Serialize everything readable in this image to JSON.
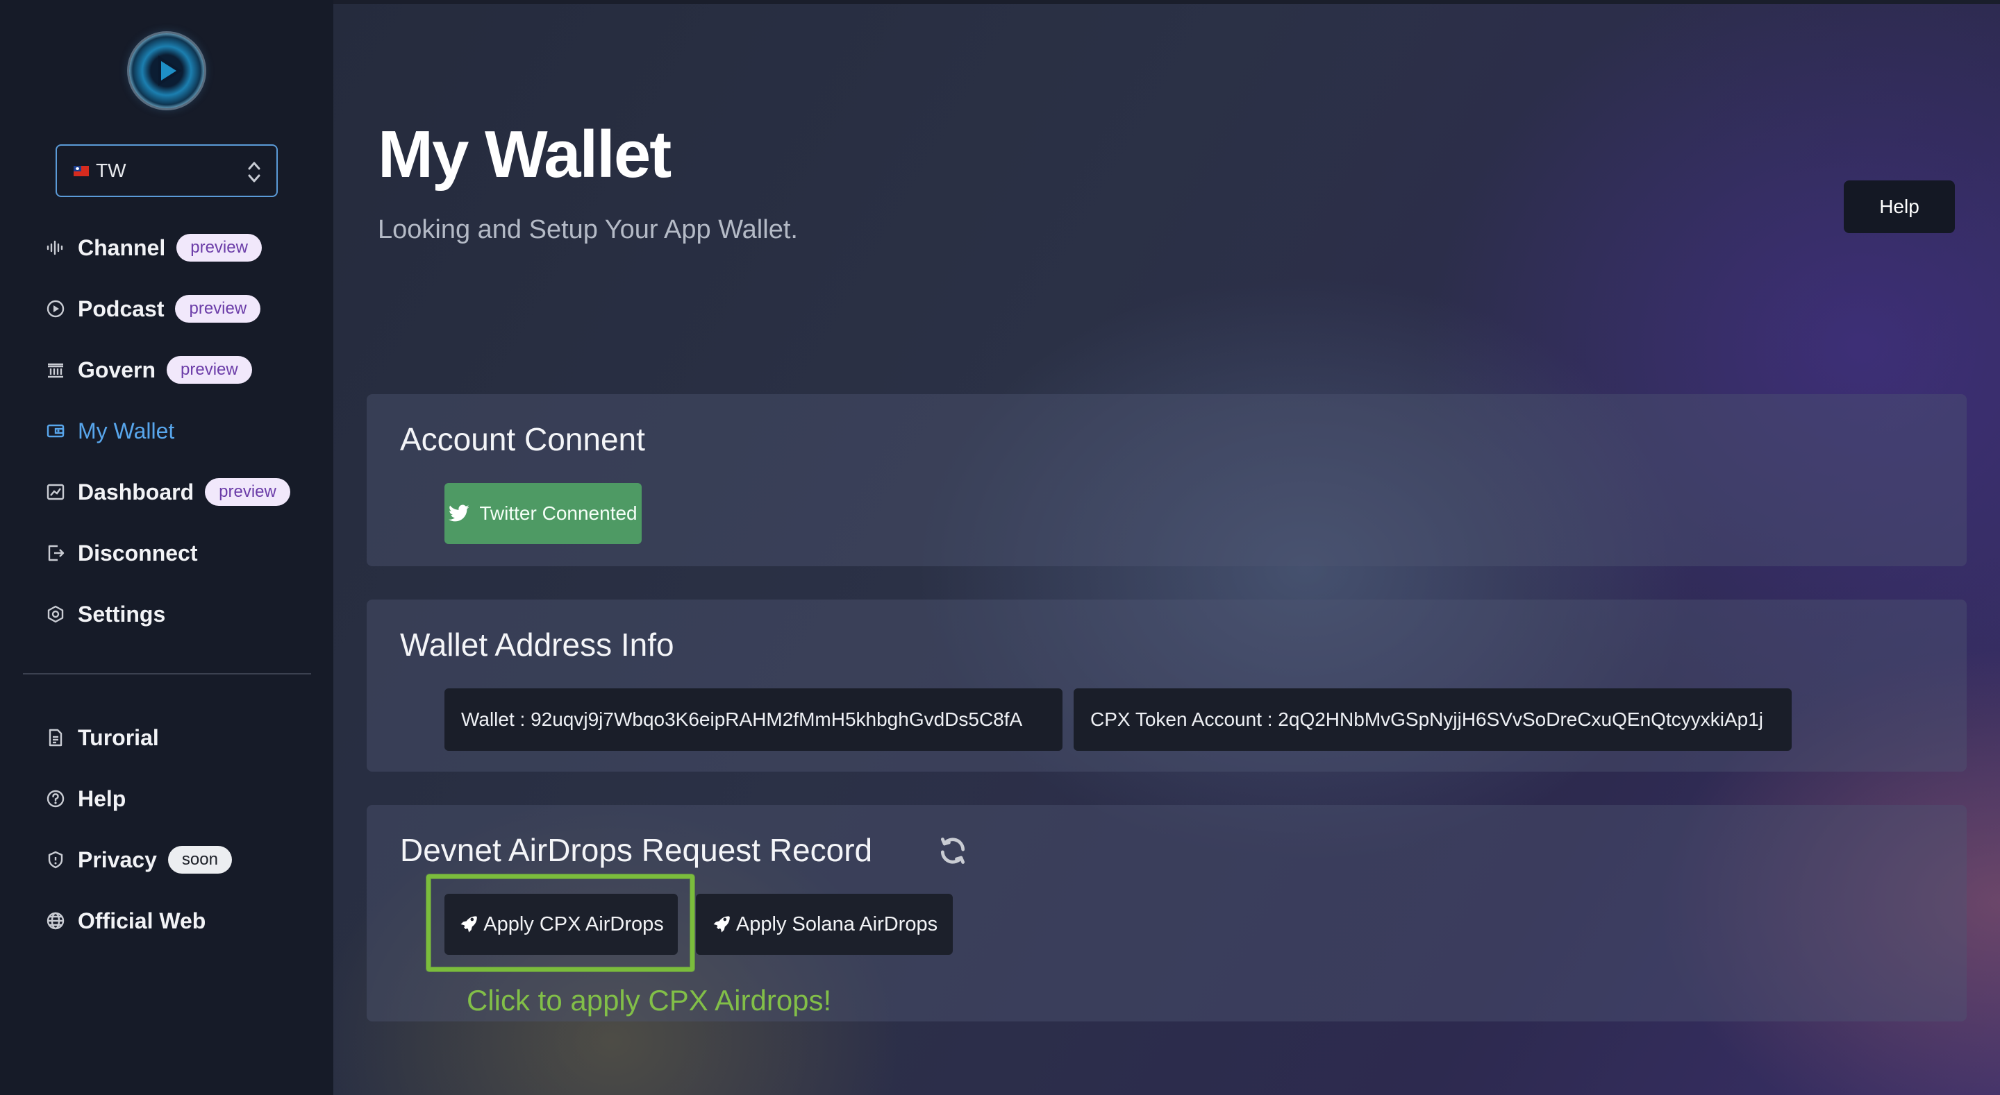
{
  "sidebar": {
    "language": "TW",
    "nav": [
      {
        "label": "Channel",
        "badge": "preview",
        "icon": "audio-wave-icon"
      },
      {
        "label": "Podcast",
        "badge": "preview",
        "icon": "play-circle-icon"
      },
      {
        "label": "Govern",
        "badge": "preview",
        "icon": "bank-icon"
      },
      {
        "label": "My Wallet",
        "badge": "",
        "icon": "wallet-icon",
        "active": true
      },
      {
        "label": "Dashboard",
        "badge": "preview",
        "icon": "chart-icon"
      },
      {
        "label": "Disconnect",
        "badge": "",
        "icon": "logout-icon"
      },
      {
        "label": "Settings",
        "badge": "",
        "icon": "hexagon-gear-icon"
      }
    ],
    "secondary": [
      {
        "label": "Turorial",
        "badge": "",
        "icon": "document-icon"
      },
      {
        "label": "Help",
        "badge": "",
        "icon": "question-circle-icon"
      },
      {
        "label": "Privacy",
        "badge": "soon",
        "icon": "shield-icon"
      },
      {
        "label": "Official Web",
        "badge": "",
        "icon": "globe-icon"
      }
    ]
  },
  "header": {
    "title": "My Wallet",
    "subtitle": "Looking and Setup Your App Wallet.",
    "help_label": "Help"
  },
  "account": {
    "title": "Account Connent",
    "twitter_label": "Twitter Connented"
  },
  "wallet_info": {
    "title": "Wallet Address Info",
    "wallet": "Wallet : 92uqvj9j7Wbqo3K6eipRAHM2fMmH5khbghGvdDs5C8fA",
    "token_account": "CPX Token Account : 2qQ2HNbMvGSpNyjjH6SVvSoDreCxuQEnQtcyyxkiAp1j"
  },
  "airdrops": {
    "title": "Devnet AirDrops Request Record",
    "cpx_label": "Apply CPX AirDrops",
    "solana_label": "Apply Solana AirDrops",
    "hint": "Click to apply CPX Airdrops!"
  },
  "colors": {
    "accent": "#58a6ec",
    "twitter_green": "#4e9a64",
    "highlight": "#7bbd3c",
    "badge_bg": "#f1e8fb",
    "badge_text": "#6b3ca8"
  }
}
